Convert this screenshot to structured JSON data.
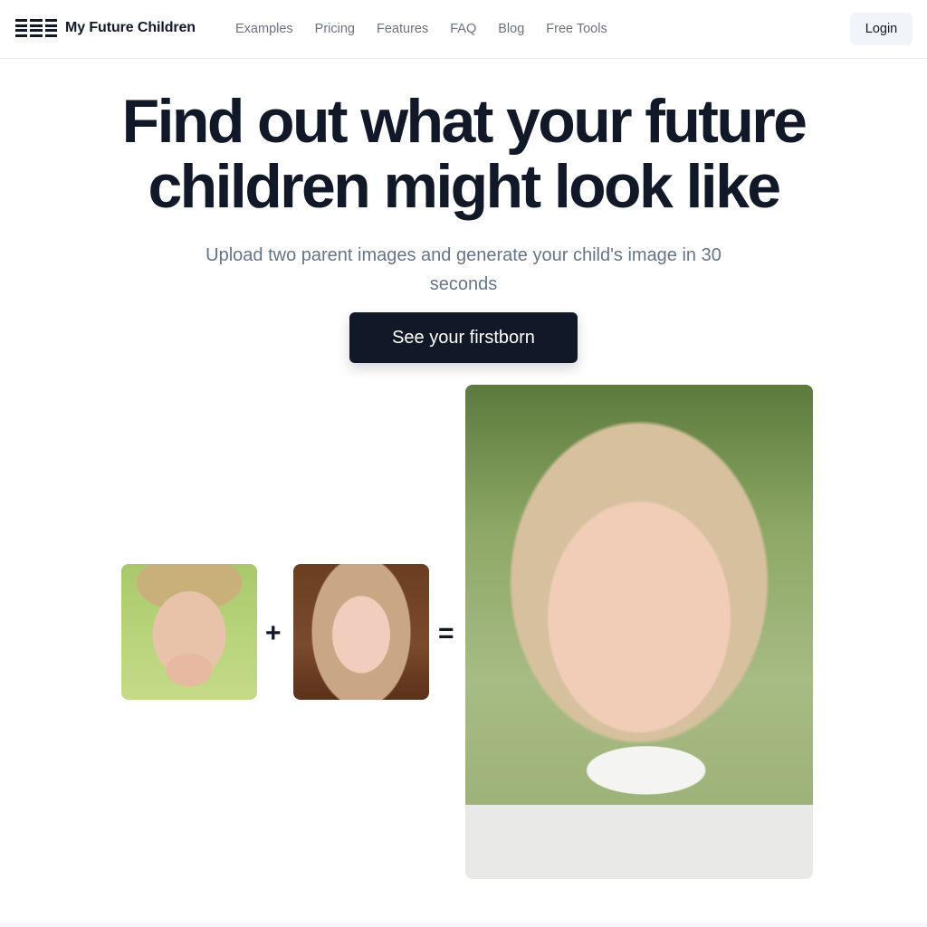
{
  "nav": {
    "brand_name": "My Future Children",
    "logo_icon": "bars-grid-icon",
    "links": [
      "Examples",
      "Pricing",
      "Features",
      "FAQ",
      "Blog",
      "Free Tools"
    ],
    "login_label": "Login"
  },
  "hero": {
    "headline_line1": "Find out what your future",
    "headline_line2": "children might look like",
    "subtitle": "Upload two parent images and generate your child's image in 30 seconds",
    "cta_label": "See your firstborn"
  },
  "showcase": {
    "parent1_alt": "Father photo",
    "parent2_alt": "Mother photo",
    "child_alt": "Generated child photo",
    "plus_symbol": "+",
    "equals_symbol": "="
  },
  "colors": {
    "primary": "#111827",
    "muted_text": "#6b7280",
    "subtitle_text": "#64748b",
    "login_bg": "#f1f5f9"
  }
}
